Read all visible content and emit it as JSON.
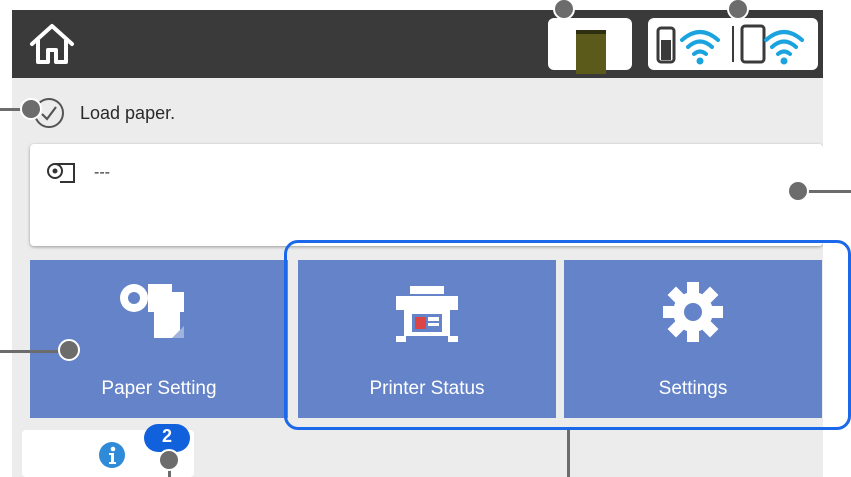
{
  "statusbar": {
    "ink_icon": "ink-level-icon",
    "network_icon": "wifi-icon",
    "ink_color": "#5b5a1a"
  },
  "status": {
    "message": "Load paper."
  },
  "paper": {
    "value": "---"
  },
  "tiles": [
    {
      "label": "Paper Setting",
      "icon": "paper-roll-icon"
    },
    {
      "label": "Printer Status",
      "icon": "printer-icon"
    },
    {
      "label": "Settings",
      "icon": "gear-icon"
    }
  ],
  "info": {
    "badge_count": "2",
    "icon": "info-icon"
  },
  "colors": {
    "tile": "#6483c8",
    "topbar": "#3a3a3a",
    "highlight": "#1c68ea",
    "badge": "#1261dc"
  }
}
